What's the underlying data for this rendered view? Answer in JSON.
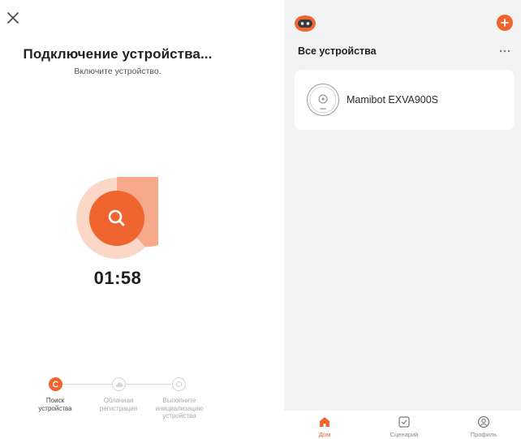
{
  "left": {
    "title": "Подключение устройства...",
    "subtitle": "Включите устройство.",
    "timer": "01:58",
    "steps": [
      {
        "label": "Поиск устройства",
        "state": "active"
      },
      {
        "label": "Облачная регистрация",
        "state": "inactive"
      },
      {
        "label": "Выполните инициализацию устройства",
        "state": "inactive"
      }
    ]
  },
  "right": {
    "section_title": "Все устройства",
    "device": {
      "name": "Mamibot EXVA900S"
    },
    "tabs": [
      {
        "label": "Дом",
        "active": true
      },
      {
        "label": "Сценарий",
        "active": false
      },
      {
        "label": "Профиль",
        "active": false
      }
    ]
  },
  "colors": {
    "accent": "#f0652f",
    "accent_light": "#f6a98b",
    "background_right": "#f3f3f3"
  },
  "icons": {
    "close": "close-icon",
    "search": "search-icon",
    "add": "plus-icon",
    "more": "more-icon",
    "home": "home-icon",
    "scene": "checkbox-icon",
    "profile": "profile-icon"
  }
}
